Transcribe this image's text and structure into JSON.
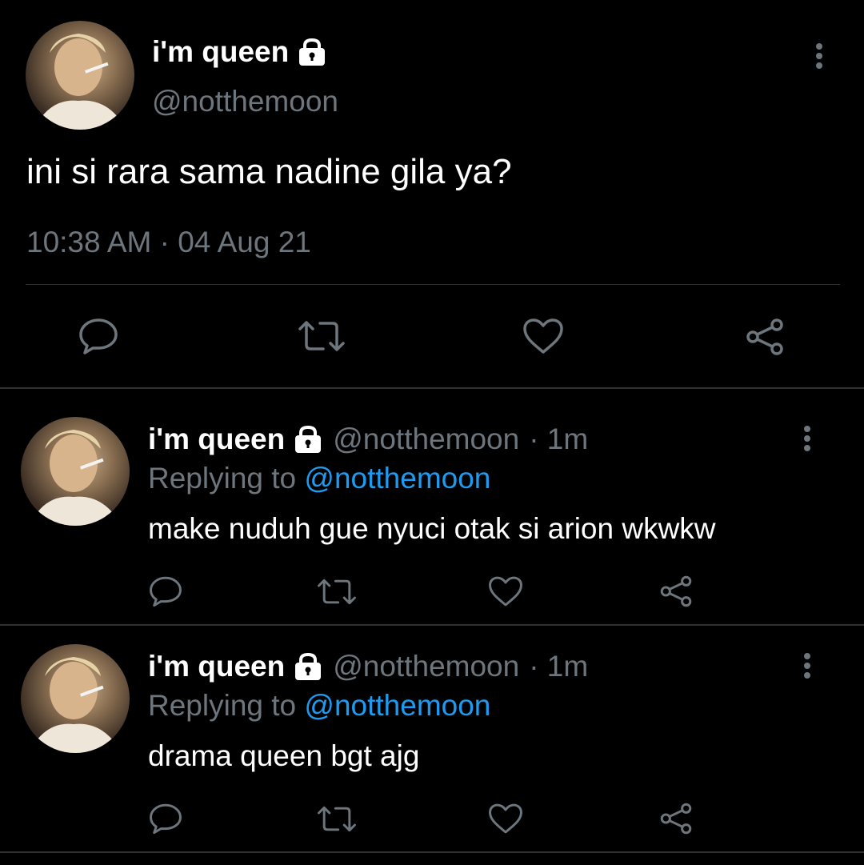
{
  "main_tweet": {
    "display_name": "i'm queen",
    "handle": "@notthemoon",
    "text": "ini si rara sama nadine gila ya?",
    "timestamp": "10:38 AM · 04 Aug 21"
  },
  "replies": [
    {
      "display_name": "i'm queen",
      "handle": "@notthemoon",
      "time": "· 1m",
      "replying_prefix": "Replying to",
      "replying_to": "@notthemoon",
      "text": "make nuduh gue nyuci otak si arion wkwkw"
    },
    {
      "display_name": "i'm queen",
      "handle": "@notthemoon",
      "time": "· 1m",
      "replying_prefix": "Replying to",
      "replying_to": "@notthemoon",
      "text": "drama queen bgt ajg"
    }
  ],
  "icons": {
    "lock": "lock-icon",
    "more": "more-vertical-icon",
    "reply": "reply-icon",
    "retweet": "retweet-icon",
    "like": "like-icon",
    "share": "share-icon"
  },
  "colors": {
    "background": "#000000",
    "text": "#ffffff",
    "muted": "#6e767d",
    "link": "#1d9bf0",
    "divider": "#2f3336"
  }
}
